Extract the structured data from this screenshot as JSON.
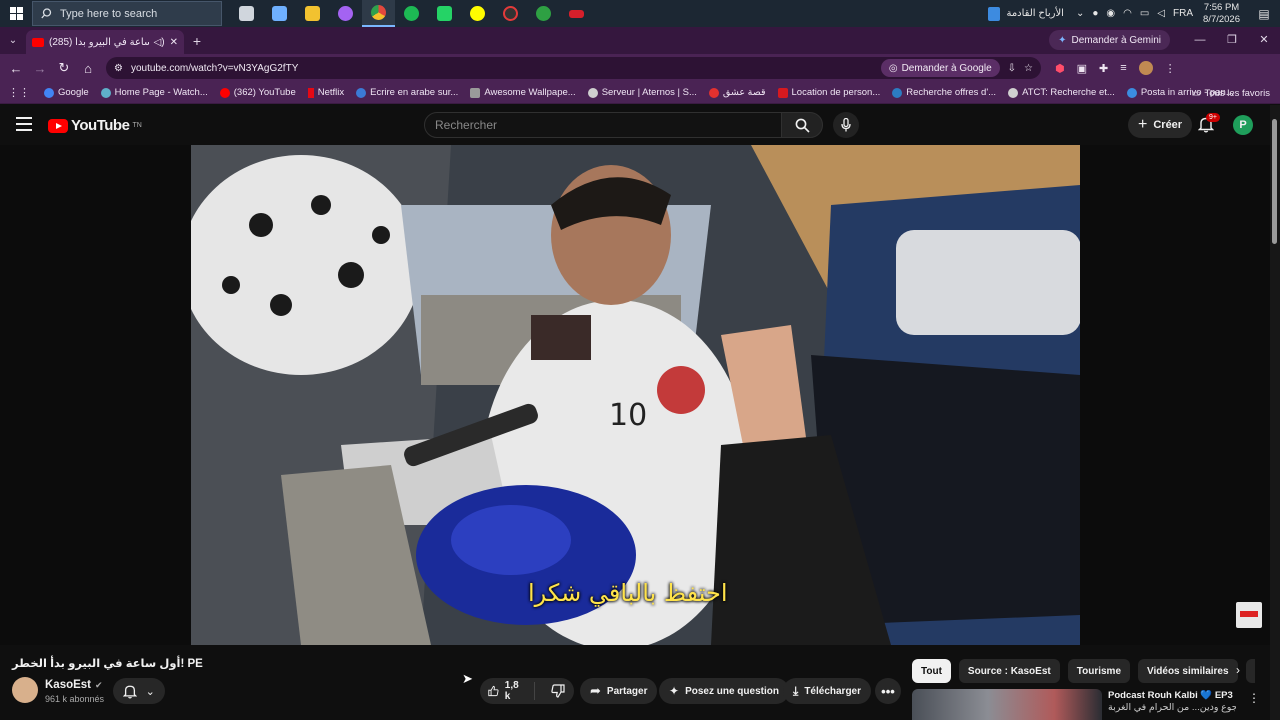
{
  "taskbar": {
    "search_placeholder": "Type here to search",
    "weather_text": "الأرباح القادمة",
    "language": "FRA",
    "time": "7:56 PM",
    "date": "8/7/2026",
    "apps": [
      {
        "name": "task-view-icon",
        "color": "#d0d6dd"
      },
      {
        "name": "meet-icon",
        "color": "#6fb0ff"
      },
      {
        "name": "file-explorer-icon",
        "color": "#f2c230"
      },
      {
        "name": "messenger-icon",
        "color": "#a463f2"
      },
      {
        "name": "chrome-icon",
        "color": "#e3483d"
      },
      {
        "name": "spotify-icon",
        "color": "#1db954"
      },
      {
        "name": "whatsapp-icon",
        "color": "#25d366"
      },
      {
        "name": "snapchat-icon",
        "color": "#fffc00"
      },
      {
        "name": "recorder-icon",
        "color": "#e33a3a"
      },
      {
        "name": "xbox-icon",
        "color": "#2ea043"
      },
      {
        "name": "app-icon",
        "color": "#d61f2b"
      }
    ]
  },
  "browser": {
    "tab_title": "(285) أول ساعة في البيرو بدأ",
    "gemini_button": "Demander à Gemini",
    "url": "youtube.com/watch?v=vN3YAgG2fTY",
    "ask_google": "Demander à Google",
    "bookmarks": [
      {
        "label": "Google",
        "color": "#4285f4"
      },
      {
        "label": "Home Page - Watch...",
        "color": "#5fb0c9"
      },
      {
        "label": "(362) YouTube",
        "color": "#ff0000"
      },
      {
        "label": "Netflix",
        "color": "#e50914"
      },
      {
        "label": "Ecrire en arabe sur...",
        "color": "#3b7bd6"
      },
      {
        "label": "Awesome Wallpape...",
        "color": "#9a9a9a"
      },
      {
        "label": "Serveur | Aternos | S...",
        "color": "#cfcfcf"
      },
      {
        "label": "قصة عشق",
        "color": "#e4312f"
      },
      {
        "label": "Location de person...",
        "color": "#d7191f"
      },
      {
        "label": "Recherche offres d'...",
        "color": "#2c7cc1"
      },
      {
        "label": "ATCT: Recherche et...",
        "color": "#d0d0d0"
      },
      {
        "label": "Posta in arrivo - pan...",
        "color": "#3b8de0"
      }
    ],
    "all_bookmarks": "Tous les favoris"
  },
  "youtube": {
    "logo_text": "YouTube",
    "logo_suffix": "TN",
    "search_placeholder": "Rechercher",
    "create_label": "Créer",
    "notif_badge": "9+",
    "avatar_letter": "P",
    "subtitle": "احتفظ بالباقي شكرا",
    "video_title": "أول ساعة في البيرو بدأ الخطر! PE",
    "channel_name": "KasoEst",
    "subscribers": "961 k abonnés",
    "likes": "1,8 k",
    "share_label": "Partager",
    "ask_label": "Posez une question",
    "download_label": "Télécharger",
    "chips": [
      "Tout",
      "Source : KasoEst",
      "Tourisme",
      "Vidéos similaires",
      "Pou"
    ],
    "rec_title_line1": "Podcast Rouh Kalbi 💙 EP3 |",
    "rec_title_line2": "مخدرات، جوع ودين... من الحرام في الغربة"
  }
}
